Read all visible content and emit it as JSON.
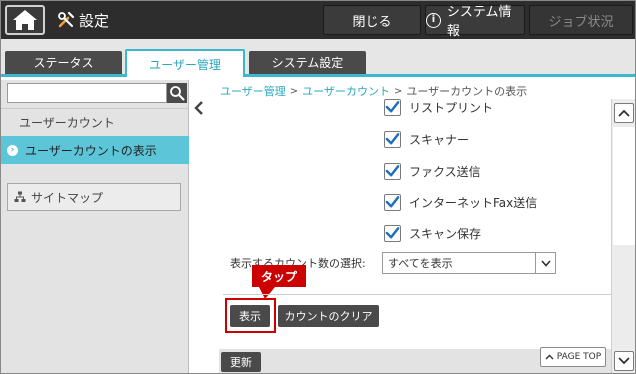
{
  "header": {
    "home_icon": "home-icon",
    "settings_icon": "tools-icon",
    "title": "設定",
    "close_label": "閉じる",
    "system_info_label": "システム情報",
    "job_status_label": "ジョブ状況"
  },
  "tabs": [
    {
      "label": "ステータス",
      "active": false
    },
    {
      "label": "ユーザー管理",
      "active": true
    },
    {
      "label": "システム設定",
      "active": false
    }
  ],
  "sidebar": {
    "search_placeholder": "",
    "items": [
      {
        "label": "ユーザーカウント",
        "selected": false
      },
      {
        "label": "ユーザーカウントの表示",
        "selected": true
      }
    ],
    "sitemap_label": "サイトマップ"
  },
  "breadcrumb": {
    "items": [
      "ユーザー管理",
      "ユーザーカウント",
      "ユーザーカウントの表示"
    ],
    "separator": ">"
  },
  "main": {
    "checkboxes": [
      {
        "label": "リストプリント",
        "checked": true
      },
      {
        "label": "スキャナー",
        "checked": true
      },
      {
        "label": "ファクス送信",
        "checked": true
      },
      {
        "label": "インターネットFax送信",
        "checked": true
      },
      {
        "label": "スキャン保存",
        "checked": true
      }
    ],
    "count_select_label": "表示するカウント数の選択:",
    "count_select_value": "すべてを表示",
    "tap_callout": "タップ",
    "display_button": "表示",
    "clear_button": "カウントのクリア",
    "update_button": "更新",
    "page_top_button": "PAGE TOP"
  },
  "colors": {
    "accent": "#3bb8cf",
    "topbar": "#2d2d2d",
    "callout": "#cc0000",
    "button_dark": "#4a4a4a"
  }
}
